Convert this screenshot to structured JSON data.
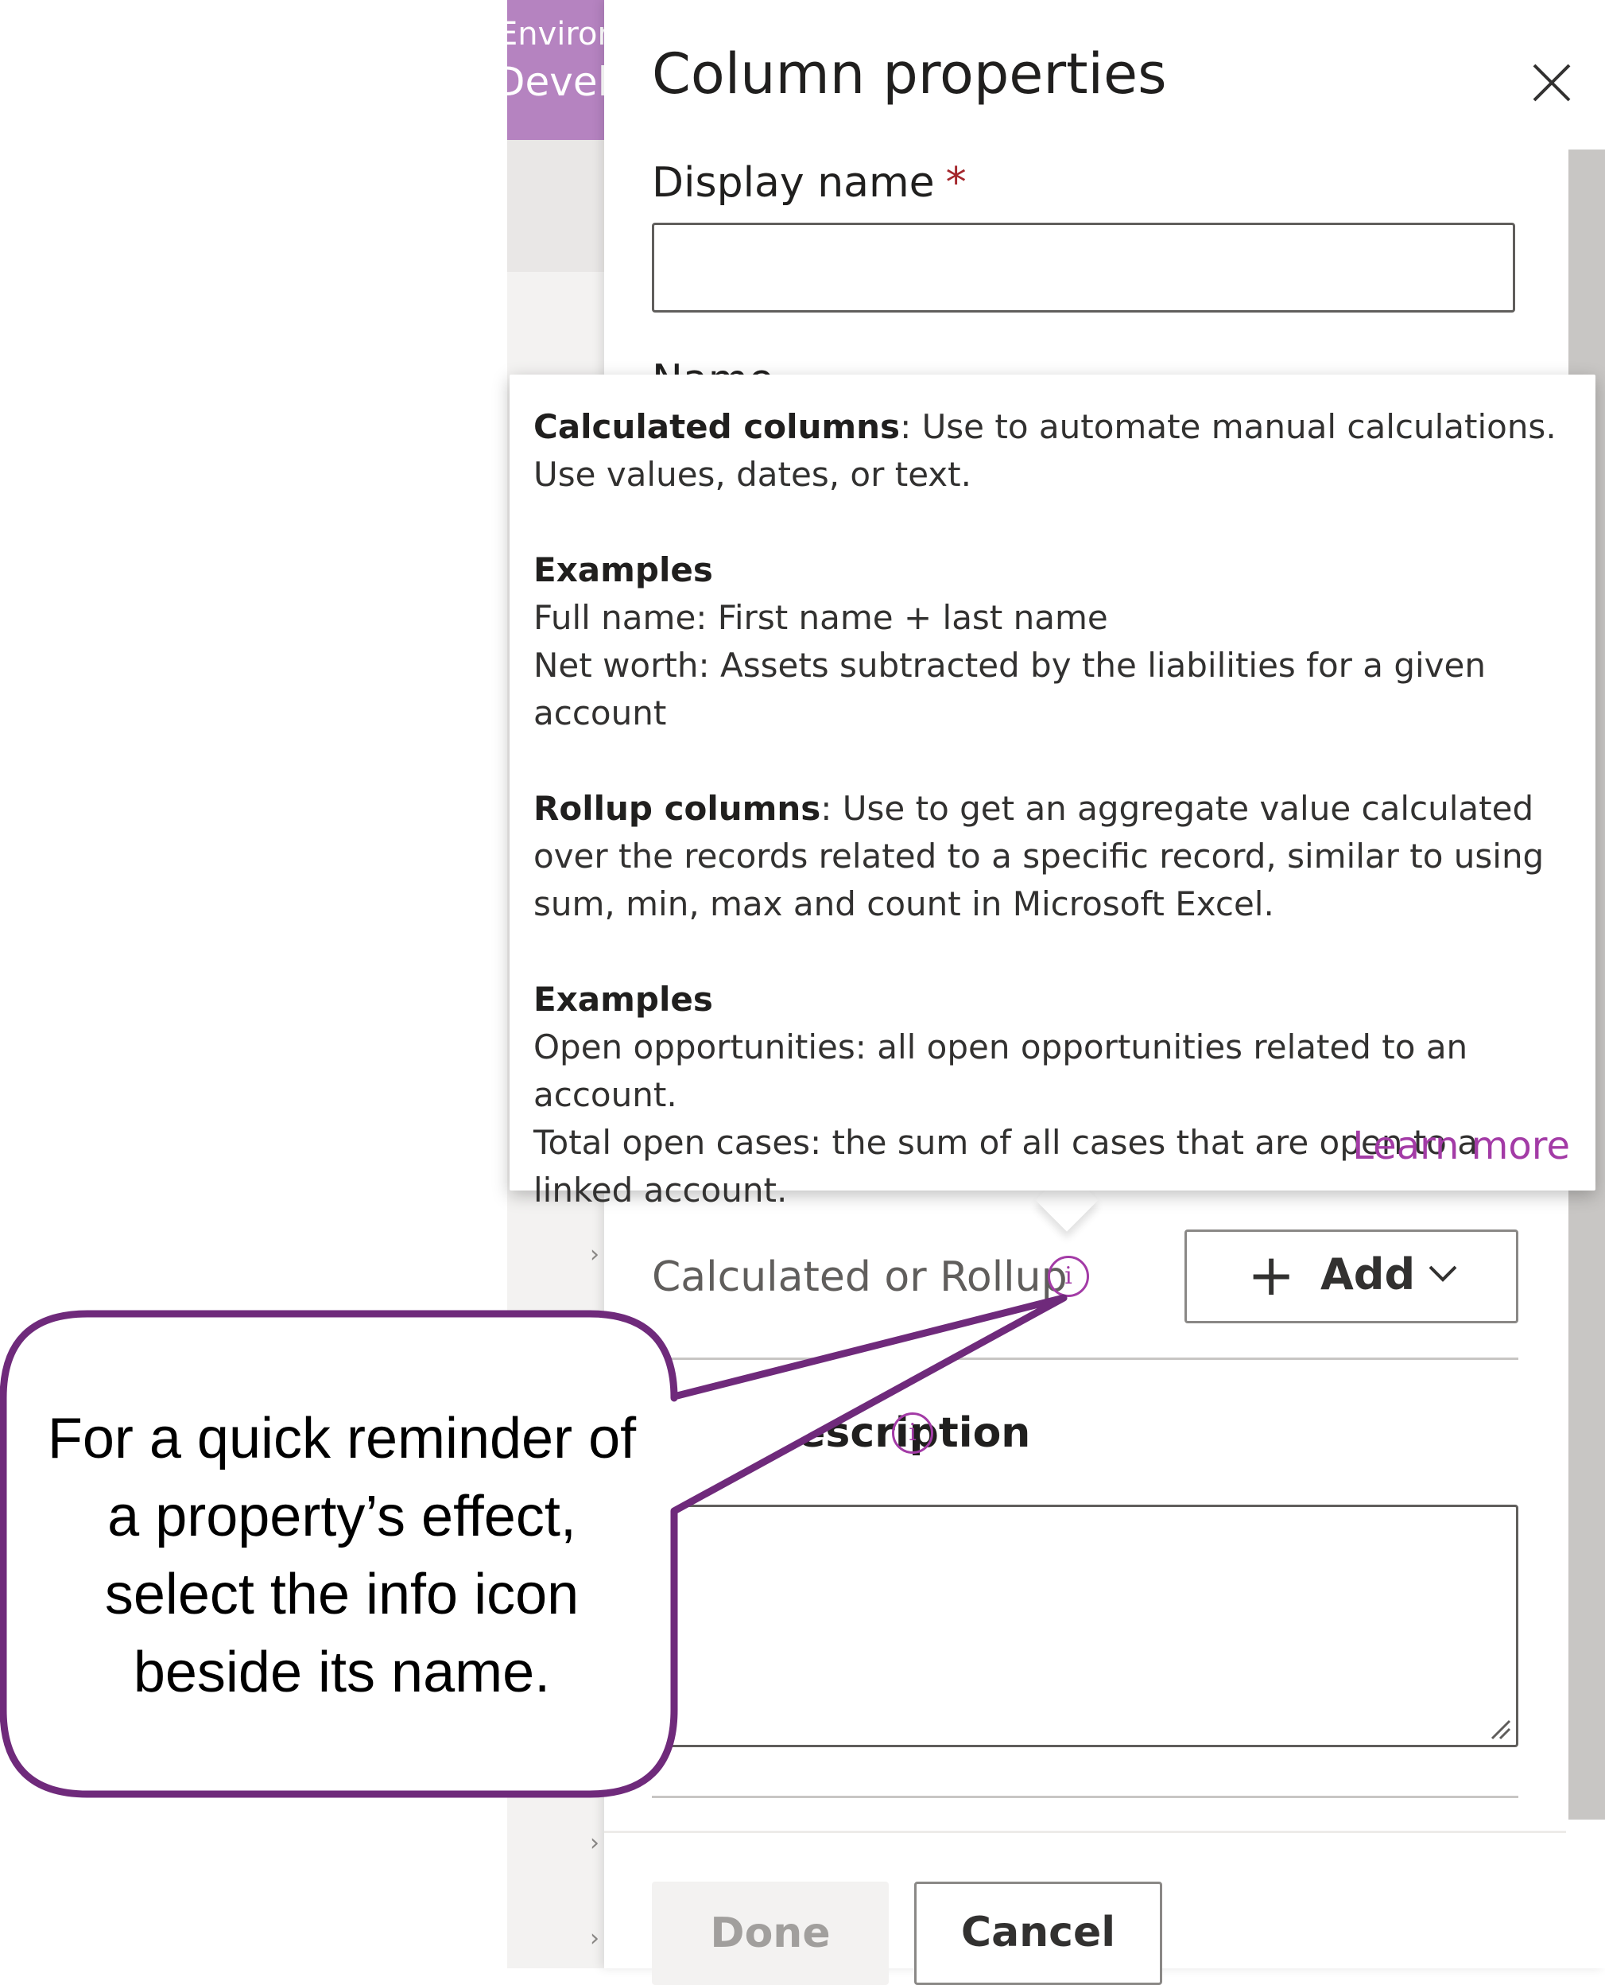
{
  "background": {
    "environment_label": "Environment",
    "environment_name": "Developer"
  },
  "panel": {
    "title": "Column properties",
    "display_name_label": "Display name",
    "required_marker": "*",
    "display_name_value": "",
    "hidden_label_fragment": "Name",
    "calculated_label": "Calculated or Rollup",
    "add_button_label": "Add",
    "description_label": "Description",
    "description_value": "",
    "done_label": "Done",
    "cancel_label": "Cancel"
  },
  "tooltip": {
    "calc_title": "Calculated columns",
    "calc_text": ": Use to automate manual calculations. Use values, dates, or text.",
    "examples_1_title": "Examples",
    "example_1a": "Full name: First name + last name",
    "example_1b": "Net worth: Assets subtracted by the liabilities for a given account",
    "rollup_title": "Rollup columns",
    "rollup_text": ": Use to get an aggregate value calculated over the records related to a specific record, similar to using sum, min, max and count in Microsoft Excel.",
    "examples_2_title": "Examples",
    "example_2a": "Open opportunities: all open opportunities related to an account.",
    "example_2b": "Total open cases: the sum of all cases that are open to a linked account.",
    "learn_more": "Learn more"
  },
  "callout": {
    "text": "For a quick reminder of a property’s effect, select the info icon beside its name."
  },
  "colors": {
    "accent": "#a33ba6",
    "environment_banner": "#b583c0",
    "callout_border": "#6f2a7b"
  }
}
